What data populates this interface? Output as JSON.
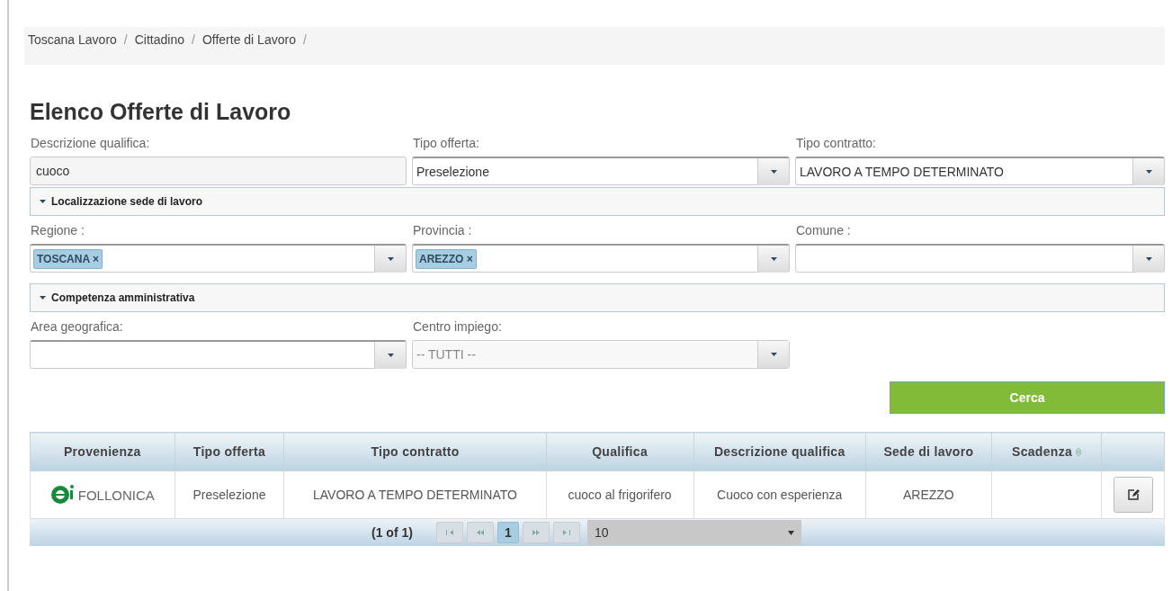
{
  "breadcrumb": [
    {
      "label": "Toscana Lavoro",
      "separator": "/"
    },
    {
      "label": "Cittadino",
      "separator": "/"
    },
    {
      "label": "Offerte di Lavoro",
      "separator": "/"
    }
  ],
  "title": "Elenco Offerte di Lavoro",
  "filters_top": [
    {
      "label": "Descrizione qualifica:",
      "kind": "text",
      "value": "cuoco"
    },
    {
      "label": "Tipo offerta:",
      "kind": "select",
      "value": "Preselezione"
    },
    {
      "label": "Tipo contratto:",
      "kind": "select",
      "value": "LAVORO A TEMPO DETERMINATO"
    }
  ],
  "section_location": {
    "title": "Localizzazione sede di lavoro",
    "expanded": true
  },
  "filters_location": [
    {
      "label": "Regione :",
      "kind": "multi",
      "tags": [
        {
          "label": "TOSCANA",
          "remove": "×"
        }
      ]
    },
    {
      "label": "Provincia :",
      "kind": "multi",
      "tags": [
        {
          "label": "AREZZO",
          "remove": "×"
        }
      ]
    },
    {
      "label": "Comune :",
      "kind": "multi"
    }
  ],
  "section_admin": {
    "title": "Competenza amministrativa",
    "expanded": true
  },
  "filters_admin": [
    {
      "label": "Area geografica:",
      "kind": "select"
    },
    {
      "label": "Centro impiego:",
      "kind": "select",
      "value": "-- TUTTI --",
      "disabled": true
    }
  ],
  "search_button": "Cerca",
  "table": {
    "columns": [
      {
        "label": "Provenienza"
      },
      {
        "label": "Tipo offerta"
      },
      {
        "label": "Tipo contratto"
      },
      {
        "label": "Qualifica"
      },
      {
        "label": "Descrizione qualifica"
      },
      {
        "label": "Sede di lavoro"
      },
      {
        "label": "Scadenza",
        "sortable": true
      },
      {}
    ],
    "rows": [
      {
        "provenienza": "FOLLONICA",
        "tipo_offerta": "Preselezione",
        "tipo_contratto": "LAVORO A TEMPO DETERMINATO",
        "qualifica": "cuoco al frigorifero",
        "descrizione": "Cuoco con esperienza",
        "sede": "AREZZO"
      }
    ]
  },
  "paginator": {
    "summary": "(1 of 1)",
    "pages": [
      {
        "label": "1",
        "selected": true
      }
    ],
    "rows_per_page": "10"
  }
}
